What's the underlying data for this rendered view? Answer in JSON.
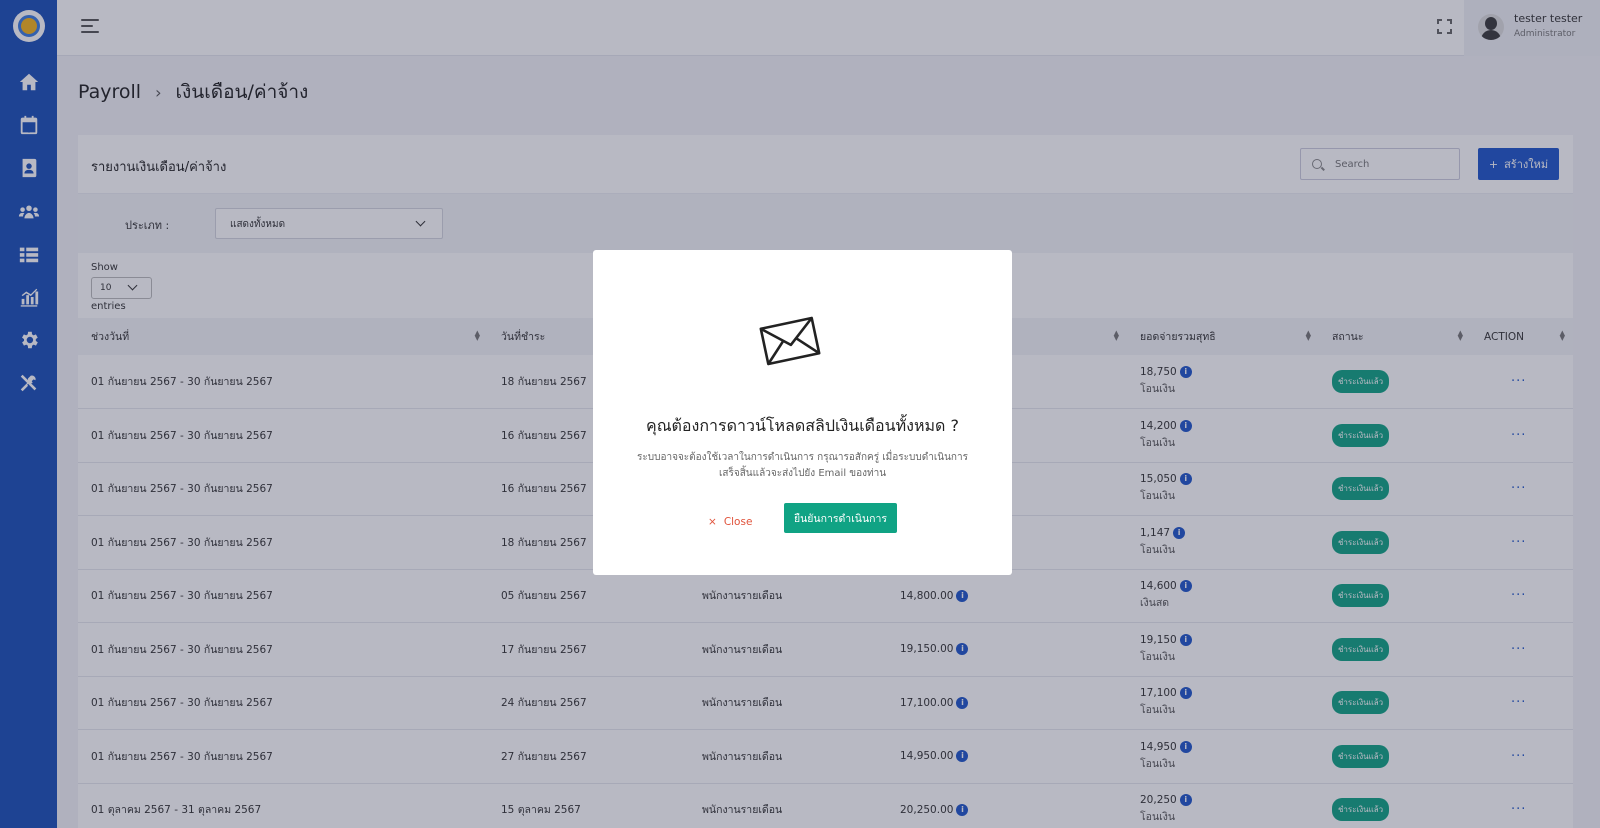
{
  "topbar": {
    "user_name": "tester tester",
    "user_role": "Administrator"
  },
  "breadcrumb": {
    "root": "Payroll",
    "current": "เงินเดือน/ค่าจ้าง"
  },
  "card": {
    "title": "รายงานเงินเดือน/ค่าจ้าง",
    "search_placeholder": "Search",
    "create_label": "สร้างใหม่"
  },
  "filter": {
    "label": "ประเภท :",
    "value": "แสดงทั้งหมด"
  },
  "length": {
    "show": "Show",
    "value": "10",
    "entries": "entries"
  },
  "table": {
    "headers": [
      "ช่วงวันที่",
      "วันที่ชำระ",
      "",
      "",
      "ยอดจ่ายรวมสุทธิ",
      "สถานะ",
      "ACTION"
    ],
    "rows": [
      {
        "period": "01 กันยายน 2567 - 30 กันยายน 2567",
        "paid_date": "18 กันยายน 2567",
        "type": "",
        "amount": "",
        "net": "18,750",
        "method": "โอนเงิน",
        "status": "ชำระเงินแล้ว"
      },
      {
        "period": "01 กันยายน 2567 - 30 กันยายน 2567",
        "paid_date": "16 กันยายน 2567",
        "type": "",
        "amount": "",
        "net": "14,200",
        "method": "โอนเงิน",
        "status": "ชำระเงินแล้ว"
      },
      {
        "period": "01 กันยายน 2567 - 30 กันยายน 2567",
        "paid_date": "16 กันยายน 2567",
        "type": "",
        "amount": "",
        "net": "15,050",
        "method": "โอนเงิน",
        "status": "ชำระเงินแล้ว"
      },
      {
        "period": "01 กันยายน 2567 - 30 กันยายน 2567",
        "paid_date": "18 กันยายน 2567",
        "type": "",
        "amount": "",
        "net": "1,147",
        "method": "โอนเงิน",
        "status": "ชำระเงินแล้ว"
      },
      {
        "period": "01 กันยายน 2567 - 30 กันยายน 2567",
        "paid_date": "05 กันยายน 2567",
        "type": "พนักงานรายเดือน",
        "amount": "14,800.00",
        "net": "14,600",
        "method": "เงินสด",
        "status": "ชำระเงินแล้ว"
      },
      {
        "period": "01 กันยายน 2567 - 30 กันยายน 2567",
        "paid_date": "17 กันยายน 2567",
        "type": "พนักงานรายเดือน",
        "amount": "19,150.00",
        "net": "19,150",
        "method": "โอนเงิน",
        "status": "ชำระเงินแล้ว"
      },
      {
        "period": "01 กันยายน 2567 - 30 กันยายน 2567",
        "paid_date": "24 กันยายน 2567",
        "type": "พนักงานรายเดือน",
        "amount": "17,100.00",
        "net": "17,100",
        "method": "โอนเงิน",
        "status": "ชำระเงินแล้ว"
      },
      {
        "period": "01 กันยายน 2567 - 30 กันยายน 2567",
        "paid_date": "27 กันยายน 2567",
        "type": "พนักงานรายเดือน",
        "amount": "14,950.00",
        "net": "14,950",
        "method": "โอนเงิน",
        "status": "ชำระเงินแล้ว"
      },
      {
        "period": "01 ตุลาคม 2567 - 31 ตุลาคม 2567",
        "paid_date": "15 ตุลาคม 2567",
        "type": "พนักงานรายเดือน",
        "amount": "20,250.00",
        "net": "20,250",
        "method": "โอนเงิน",
        "status": "ชำระเงินแล้ว"
      }
    ]
  },
  "modal": {
    "title": "คุณต้องการดาวน์โหลดสลิปเงินเดือนทั้งหมด ?",
    "body": "ระบบอาจจะต้องใช้เวลาในการดำเนินการ กรุณารอสักครู่ เมื่อระบบดำเนินการเสร็จสิ้นแล้วจะส่งไปยัง Email ของท่าน",
    "close_label": "Close",
    "confirm_label": "ยืนยันการดำเนินการ"
  },
  "colors": {
    "sidebar": "#1a4fb8",
    "primary": "#1f56c9",
    "success": "#10a384",
    "danger": "#e0523a"
  },
  "icons": [
    "home-icon",
    "calendar-dollar-icon",
    "contact-book-icon",
    "users-gear-icon",
    "list-icon",
    "chart-icon",
    "gear-icon",
    "tools-icon",
    "mail-icon"
  ]
}
